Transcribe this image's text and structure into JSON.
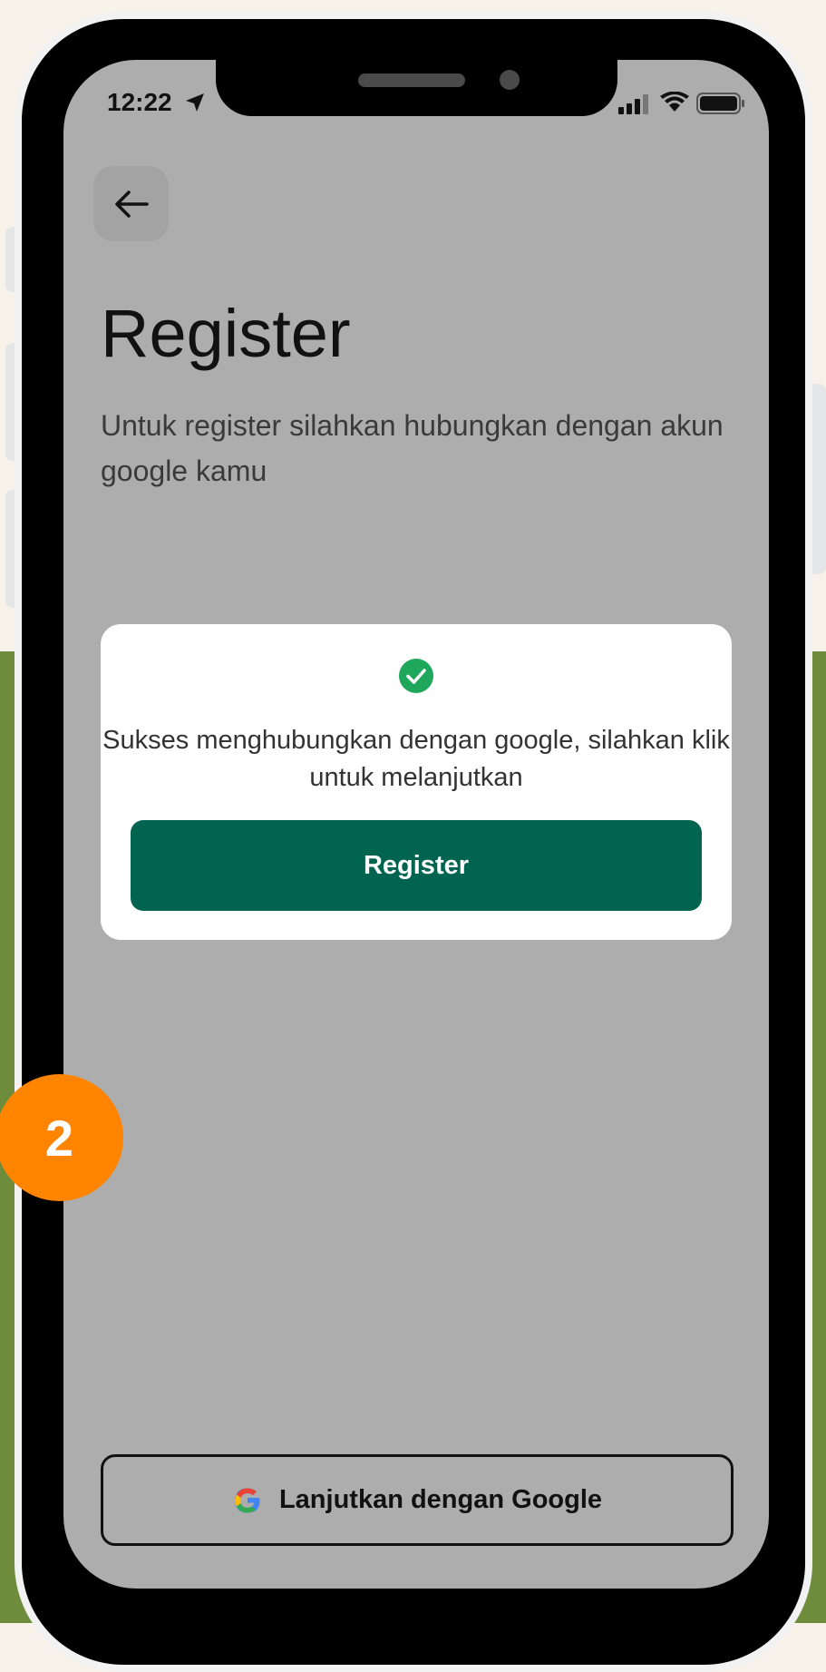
{
  "status_bar": {
    "time": "12:22"
  },
  "page": {
    "title": "Register",
    "subtitle": "Untuk register silahkan hubungkan dengan akun google kamu"
  },
  "modal": {
    "message": "Sukses menghubungkan dengan google, silahkan klik untuk melanjutkan",
    "button_label": "Register"
  },
  "google_button": {
    "label": "Lanjutkan dengan Google"
  },
  "step_badge": {
    "number": "2"
  },
  "colors": {
    "primary": "#006450",
    "badge": "#ff8400",
    "success": "#1fa85c",
    "overlay": "#adadad",
    "background_green": "#6f8b3c",
    "background_cream": "#f8f3ea"
  },
  "icons": [
    "location-arrow-icon",
    "signal-icon",
    "wifi-icon",
    "battery-icon",
    "back-arrow-icon",
    "check-circle-icon",
    "google-icon"
  ]
}
